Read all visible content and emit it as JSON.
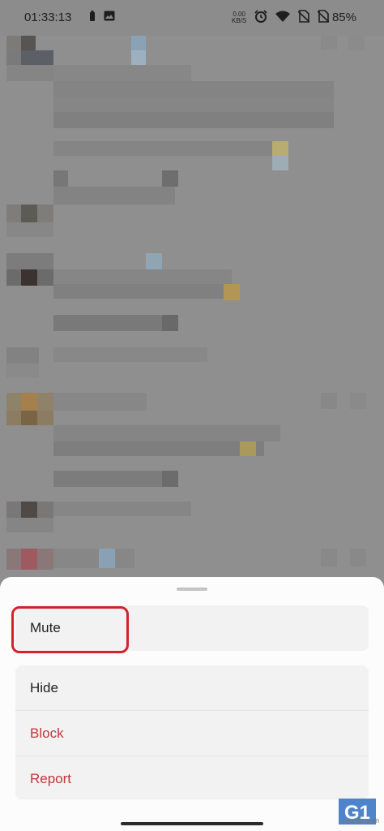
{
  "status_bar": {
    "time": "01:33:13",
    "net_speed": "0.00",
    "net_unit": "KB/S",
    "battery": "85%",
    "icons": [
      "battery-saver-icon",
      "gallery-icon",
      "alarm-icon",
      "wifi-icon",
      "no-sim-icon",
      "no-sim-icon",
      "battery-percent-text"
    ]
  },
  "sheet": {
    "groups": [
      {
        "items": [
          {
            "label": "Mute",
            "style": "normal"
          }
        ]
      },
      {
        "items": [
          {
            "label": "Hide",
            "style": "normal"
          },
          {
            "label": "Block",
            "style": "danger"
          },
          {
            "label": "Report",
            "style": "danger"
          }
        ]
      }
    ]
  },
  "watermark": {
    "site": "wsxdn.com"
  },
  "colors": {
    "danger": "#c4343b",
    "highlight": "#d3222c",
    "scrim": "#8f8f8f"
  }
}
